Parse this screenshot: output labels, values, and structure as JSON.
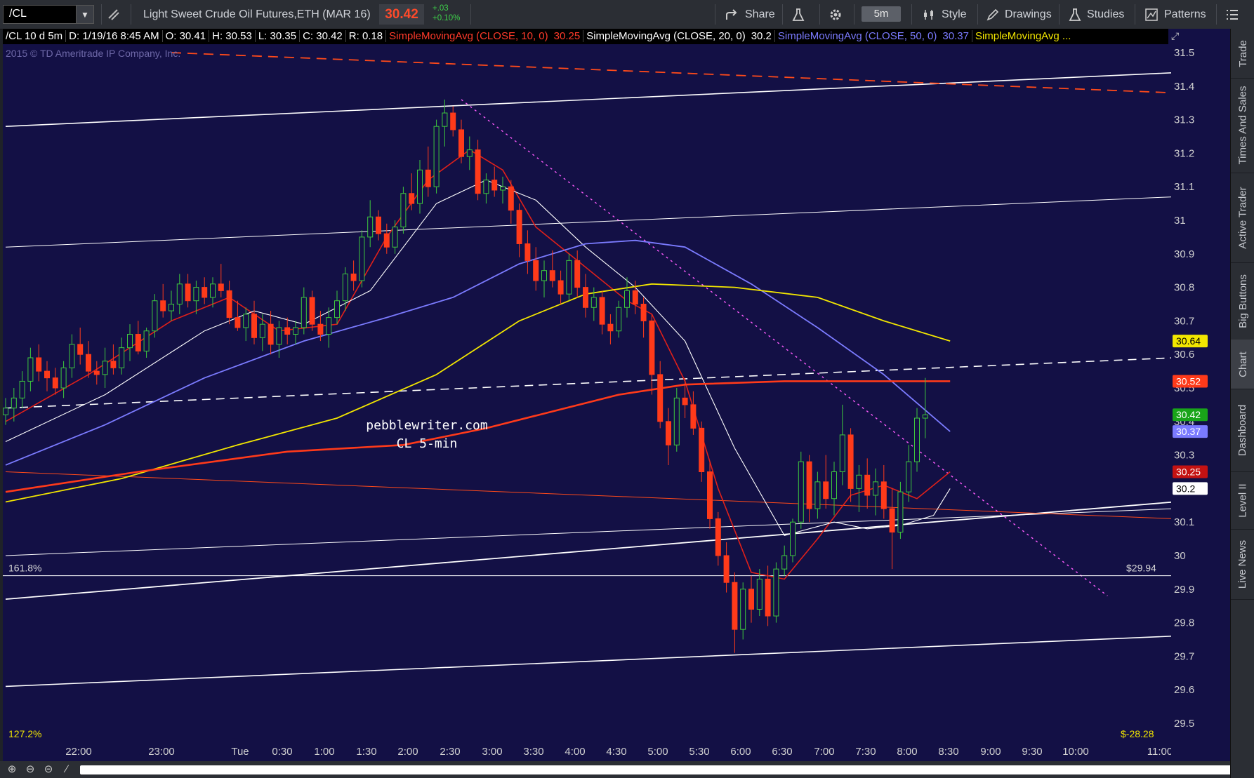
{
  "toolbar": {
    "symbol": "/CL",
    "instrument_name": "Light Sweet Crude Oil Futures,ETH (MAR 16)",
    "last_price": "30.42",
    "change_abs": "+.03",
    "change_pct": "+0.10%",
    "share_label": "Share",
    "timeframe_label": "5m",
    "style_label": "Style",
    "drawings_label": "Drawings",
    "studies_label": "Studies",
    "patterns_label": "Patterns"
  },
  "status": {
    "descriptor": "/CL 10 d 5m",
    "date": "D: 1/19/16 8:45 AM",
    "open": "O: 30.41",
    "high": "H: 30.53",
    "low": "L: 30.35",
    "close": "C: 30.42",
    "range": "R: 0.18",
    "sma10_label": "SimpleMovingAvg (CLOSE, 10, 0)",
    "sma10_value": "30.25",
    "sma20_label": "SimpleMovingAvg (CLOSE, 20, 0)",
    "sma20_value": "30.2",
    "sma50_label": "SimpleMovingAvg (CLOSE, 50, 0)",
    "sma50_value": "30.37",
    "sma_more_label": "SimpleMovingAvg ..."
  },
  "chart_data": {
    "type": "candlestick",
    "copyright": "2015 © TD Ameritrade IP Company, Inc.",
    "watermark": [
      "pebblewriter.com",
      "CL 5-min"
    ],
    "y_ticks": [
      31.5,
      31.4,
      31.3,
      31.2,
      31.1,
      31,
      30.9,
      30.8,
      30.7,
      30.6,
      30.5,
      30.4,
      30.3,
      30.2,
      30.1,
      30,
      29.9,
      29.8,
      29.7,
      29.6,
      29.5
    ],
    "y_tick_labels": [
      "31.5",
      "31.4",
      "31.3",
      "31.2",
      "31.1",
      "31",
      "30.9",
      "30.8",
      "30.7",
      "30.6",
      "30.5",
      "30.4",
      "30.3",
      "30.2",
      "30.1",
      "30",
      "29.9",
      "29.8",
      "29.7",
      "29.6",
      "29.5"
    ],
    "ylim": [
      29.44,
      31.55
    ],
    "x_labels": [
      "22:00",
      "23:00",
      "Tue",
      "0:30",
      "1:00",
      "1:30",
      "2:00",
      "2:30",
      "3:00",
      "3:30",
      "4:00",
      "4:30",
      "5:00",
      "5:30",
      "6:00",
      "6:30",
      "7:00",
      "7:30",
      "8:00",
      "8:30",
      "9:00",
      "9:30",
      "10:00",
      "11:00"
    ],
    "price_badges": [
      {
        "label": "30.64",
        "value": 30.64,
        "color": "#f2e600",
        "text_color": "#000000"
      },
      {
        "label": "30.52",
        "value": 30.52,
        "color": "#ff3a1a",
        "text_color": "#ffffff"
      },
      {
        "label": "30.42",
        "value": 30.42,
        "color": "#19a419",
        "text_color": "#ffffff"
      },
      {
        "label": "30.37",
        "value": 30.37,
        "color": "#7b7bff",
        "text_color": "#ffffff"
      },
      {
        "label": "30.25",
        "value": 30.25,
        "color": "#c41212",
        "text_color": "#ffffff"
      },
      {
        "label": "30.2",
        "value": 30.2,
        "color": "#ffffff",
        "text_color": "#000000"
      }
    ],
    "annotations": {
      "fib_left_top": "161.8%",
      "fib_left_bottom": "127.2%",
      "fib_right_top": "$29.94",
      "fib_right_bottom": "$-28.28",
      "fib_level": 29.94
    },
    "candles": [
      [
        30.42,
        30.47,
        30.39,
        30.44
      ],
      [
        30.44,
        30.5,
        30.4,
        30.47
      ],
      [
        30.47,
        30.55,
        30.44,
        30.52
      ],
      [
        30.52,
        30.62,
        30.49,
        30.59
      ],
      [
        30.59,
        30.63,
        30.52,
        30.55
      ],
      [
        30.55,
        30.58,
        30.49,
        30.53
      ],
      [
        30.53,
        30.56,
        30.48,
        30.5
      ],
      [
        30.5,
        30.58,
        30.47,
        30.56
      ],
      [
        30.56,
        30.66,
        30.53,
        30.63
      ],
      [
        30.63,
        30.68,
        30.57,
        30.6
      ],
      [
        30.6,
        30.64,
        30.53,
        30.55
      ],
      [
        30.55,
        30.58,
        30.51,
        30.54
      ],
      [
        30.54,
        30.62,
        30.5,
        30.58
      ],
      [
        30.58,
        30.63,
        30.54,
        30.56
      ],
      [
        30.56,
        30.65,
        30.54,
        30.62
      ],
      [
        30.62,
        30.69,
        30.58,
        30.66
      ],
      [
        30.66,
        30.7,
        30.6,
        30.61
      ],
      [
        30.61,
        30.68,
        30.59,
        30.67
      ],
      [
        30.67,
        30.78,
        30.65,
        30.76
      ],
      [
        30.76,
        30.81,
        30.71,
        30.73
      ],
      [
        30.73,
        30.79,
        30.7,
        30.75
      ],
      [
        30.75,
        30.84,
        30.72,
        30.81
      ],
      [
        30.81,
        30.84,
        30.74,
        30.76
      ],
      [
        30.76,
        30.82,
        30.72,
        30.8
      ],
      [
        30.8,
        30.83,
        30.75,
        30.77
      ],
      [
        30.77,
        30.83,
        30.74,
        30.81
      ],
      [
        30.81,
        30.87,
        30.77,
        30.79
      ],
      [
        30.79,
        30.82,
        30.69,
        30.71
      ],
      [
        30.71,
        30.76,
        30.67,
        30.68
      ],
      [
        30.68,
        30.74,
        30.64,
        30.72
      ],
      [
        30.72,
        30.76,
        30.63,
        30.65
      ],
      [
        30.65,
        30.72,
        30.61,
        30.69
      ],
      [
        30.69,
        30.73,
        30.6,
        30.63
      ],
      [
        30.63,
        30.7,
        30.59,
        30.68
      ],
      [
        30.68,
        30.71,
        30.63,
        30.66
      ],
      [
        30.66,
        30.7,
        30.63,
        30.68
      ],
      [
        30.68,
        30.8,
        30.66,
        30.77
      ],
      [
        30.77,
        30.79,
        30.67,
        30.69
      ],
      [
        30.69,
        30.73,
        30.64,
        30.66
      ],
      [
        30.66,
        30.74,
        30.62,
        30.71
      ],
      [
        30.71,
        30.79,
        30.69,
        30.76
      ],
      [
        30.76,
        30.86,
        30.73,
        30.84
      ],
      [
        30.84,
        30.88,
        30.79,
        30.82
      ],
      [
        30.82,
        30.97,
        30.8,
        30.95
      ],
      [
        30.95,
        31.06,
        30.92,
        31.01
      ],
      [
        31.01,
        31.03,
        30.94,
        30.96
      ],
      [
        30.96,
        30.99,
        30.9,
        30.92
      ],
      [
        30.92,
        31.0,
        30.9,
        30.98
      ],
      [
        30.98,
        31.1,
        30.96,
        31.08
      ],
      [
        31.08,
        31.14,
        31.03,
        31.05
      ],
      [
        31.05,
        31.18,
        31.02,
        31.15
      ],
      [
        31.15,
        31.22,
        31.07,
        31.1
      ],
      [
        31.1,
        31.3,
        31.08,
        31.28
      ],
      [
        31.28,
        31.36,
        31.22,
        31.32
      ],
      [
        31.32,
        31.34,
        31.25,
        31.27
      ],
      [
        31.27,
        31.3,
        31.17,
        31.19
      ],
      [
        31.19,
        31.25,
        31.15,
        31.21
      ],
      [
        31.21,
        31.24,
        31.06,
        31.08
      ],
      [
        31.08,
        31.14,
        31.05,
        31.12
      ],
      [
        31.12,
        31.16,
        31.07,
        31.09
      ],
      [
        31.09,
        31.13,
        31.05,
        31.1
      ],
      [
        31.1,
        31.12,
        30.99,
        31.03
      ],
      [
        31.03,
        31.05,
        30.89,
        30.93
      ],
      [
        30.93,
        30.97,
        30.84,
        30.88
      ],
      [
        30.88,
        30.92,
        30.79,
        30.82
      ],
      [
        30.82,
        30.88,
        30.77,
        30.85
      ],
      [
        30.85,
        30.91,
        30.8,
        30.82
      ],
      [
        30.82,
        30.85,
        30.75,
        30.78
      ],
      [
        30.78,
        30.9,
        30.76,
        30.88
      ],
      [
        30.88,
        30.91,
        30.77,
        30.8
      ],
      [
        30.8,
        30.84,
        30.71,
        30.74
      ],
      [
        30.74,
        30.8,
        30.7,
        30.77
      ],
      [
        30.77,
        30.79,
        30.66,
        30.69
      ],
      [
        30.69,
        30.72,
        30.63,
        30.67
      ],
      [
        30.67,
        30.76,
        30.65,
        30.74
      ],
      [
        30.74,
        30.83,
        30.71,
        30.79
      ],
      [
        30.79,
        30.82,
        30.72,
        30.75
      ],
      [
        30.75,
        30.77,
        30.65,
        30.7
      ],
      [
        30.7,
        30.72,
        30.48,
        30.54
      ],
      [
        30.54,
        30.58,
        30.38,
        30.4
      ],
      [
        30.4,
        30.44,
        30.27,
        30.33
      ],
      [
        30.33,
        30.5,
        30.31,
        30.47
      ],
      [
        30.47,
        30.53,
        30.41,
        30.45
      ],
      [
        30.45,
        30.49,
        30.36,
        30.38
      ],
      [
        30.38,
        30.4,
        30.22,
        30.25
      ],
      [
        30.25,
        30.28,
        30.08,
        30.11
      ],
      [
        30.11,
        30.13,
        29.97,
        30.0
      ],
      [
        30.0,
        30.04,
        29.89,
        29.92
      ],
      [
        29.92,
        29.95,
        29.71,
        29.78
      ],
      [
        29.78,
        29.92,
        29.75,
        29.9
      ],
      [
        29.9,
        29.94,
        29.8,
        29.84
      ],
      [
        29.84,
        29.96,
        29.82,
        29.93
      ],
      [
        29.93,
        29.97,
        29.79,
        29.82
      ],
      [
        29.82,
        29.98,
        29.8,
        29.96
      ],
      [
        29.96,
        30.03,
        29.94,
        30.0
      ],
      [
        30.0,
        30.11,
        29.98,
        30.1
      ],
      [
        30.1,
        30.31,
        30.08,
        30.28
      ],
      [
        30.28,
        30.3,
        30.1,
        30.14
      ],
      [
        30.14,
        30.25,
        30.11,
        30.22
      ],
      [
        30.22,
        30.3,
        30.14,
        30.17
      ],
      [
        30.17,
        30.28,
        30.12,
        30.25
      ],
      [
        30.25,
        30.45,
        30.21,
        30.36
      ],
      [
        30.36,
        30.38,
        30.16,
        30.2
      ],
      [
        30.2,
        30.27,
        30.13,
        30.24
      ],
      [
        30.24,
        30.29,
        30.14,
        30.18
      ],
      [
        30.18,
        30.26,
        30.12,
        30.22
      ],
      [
        30.22,
        30.27,
        30.11,
        30.14
      ],
      [
        30.14,
        30.2,
        29.96,
        30.07
      ],
      [
        30.07,
        30.22,
        30.05,
        30.19
      ],
      [
        30.19,
        30.33,
        30.16,
        30.28
      ],
      [
        30.28,
        30.44,
        30.25,
        30.41
      ],
      [
        30.41,
        30.53,
        30.35,
        30.42
      ]
    ],
    "moving_averages": [
      {
        "name": "SMA 10",
        "color": "#e0201a",
        "width": 1.6,
        "points": [
          [
            0,
            30.4
          ],
          [
            10,
            30.54
          ],
          [
            20,
            30.7
          ],
          [
            27,
            30.77
          ],
          [
            33,
            30.67
          ],
          [
            40,
            30.69
          ],
          [
            46,
            30.95
          ],
          [
            51,
            31.12
          ],
          [
            56,
            31.21
          ],
          [
            60,
            31.15
          ],
          [
            64,
            30.98
          ],
          [
            70,
            30.86
          ],
          [
            75,
            30.76
          ],
          [
            78,
            30.72
          ],
          [
            82,
            30.52
          ],
          [
            86,
            30.2
          ],
          [
            90,
            29.95
          ],
          [
            94,
            29.93
          ],
          [
            98,
            30.05
          ],
          [
            102,
            30.18
          ],
          [
            106,
            30.21
          ],
          [
            110,
            30.17
          ],
          [
            114,
            30.25
          ]
        ]
      },
      {
        "name": "SMA 20",
        "color": "#ffffff",
        "width": 1.1,
        "points": [
          [
            0,
            30.34
          ],
          [
            12,
            30.48
          ],
          [
            24,
            30.67
          ],
          [
            30,
            30.73
          ],
          [
            36,
            30.69
          ],
          [
            44,
            30.79
          ],
          [
            52,
            31.05
          ],
          [
            58,
            31.12
          ],
          [
            64,
            31.06
          ],
          [
            70,
            30.92
          ],
          [
            76,
            30.8
          ],
          [
            82,
            30.64
          ],
          [
            88,
            30.32
          ],
          [
            94,
            30.06
          ],
          [
            100,
            30.1
          ],
          [
            104,
            30.08
          ],
          [
            108,
            30.09
          ],
          [
            112,
            30.12
          ],
          [
            114,
            30.2
          ]
        ]
      },
      {
        "name": "SMA 50",
        "color": "#7b7bff",
        "width": 1.8,
        "points": [
          [
            0,
            30.27
          ],
          [
            12,
            30.39
          ],
          [
            24,
            30.53
          ],
          [
            36,
            30.64
          ],
          [
            46,
            30.71
          ],
          [
            54,
            30.77
          ],
          [
            62,
            30.87
          ],
          [
            70,
            30.93
          ],
          [
            76,
            30.94
          ],
          [
            82,
            30.92
          ],
          [
            90,
            30.81
          ],
          [
            98,
            30.68
          ],
          [
            106,
            30.54
          ],
          [
            114,
            30.37
          ]
        ]
      },
      {
        "name": "SMA 100",
        "color": "#f2e600",
        "width": 1.8,
        "points": [
          [
            0,
            30.16
          ],
          [
            14,
            30.23
          ],
          [
            28,
            30.33
          ],
          [
            40,
            30.41
          ],
          [
            52,
            30.54
          ],
          [
            62,
            30.7
          ],
          [
            70,
            30.78
          ],
          [
            78,
            30.81
          ],
          [
            88,
            30.8
          ],
          [
            98,
            30.77
          ],
          [
            106,
            30.7
          ],
          [
            114,
            30.64
          ]
        ]
      },
      {
        "name": "SMA 200",
        "color": "#ff3a1a",
        "width": 2.6,
        "points": [
          [
            0,
            30.19
          ],
          [
            16,
            30.25
          ],
          [
            34,
            30.31
          ],
          [
            48,
            30.33
          ],
          [
            58,
            30.38
          ],
          [
            66,
            30.43
          ],
          [
            74,
            30.48
          ],
          [
            82,
            30.51
          ],
          [
            94,
            30.52
          ],
          [
            104,
            30.52
          ],
          [
            114,
            30.52
          ]
        ]
      }
    ],
    "trendlines": [
      {
        "from": [
          0,
          31.28
        ],
        "to": [
          141,
          31.44
        ],
        "color": "#ffffff",
        "width": 1.6,
        "dash": "none"
      },
      {
        "from": [
          0,
          30.92
        ],
        "to": [
          141,
          31.07
        ],
        "color": "#ffffff",
        "width": 1,
        "dash": "none"
      },
      {
        "from": [
          0,
          30.0
        ],
        "to": [
          141,
          30.14
        ],
        "color": "#ffffff",
        "width": 1,
        "dash": "none"
      },
      {
        "from": [
          0,
          29.87
        ],
        "to": [
          141,
          30.16
        ],
        "color": "#ffffff",
        "width": 1.8,
        "dash": "none"
      },
      {
        "from": [
          0,
          29.61
        ],
        "to": [
          141,
          29.76
        ],
        "color": "#ffffff",
        "width": 1.6,
        "dash": "none"
      },
      {
        "from": [
          0,
          30.44
        ],
        "to": [
          141,
          30.59
        ],
        "color": "#ffffff",
        "width": 1.6,
        "dash": "12 8"
      },
      {
        "from": [
          20,
          31.5
        ],
        "to": [
          141,
          31.38
        ],
        "color": "#ff4a1a",
        "width": 1.8,
        "dash": "14 9"
      },
      {
        "from": [
          0,
          30.25
        ],
        "to": [
          141,
          30.11
        ],
        "color": "#ff4a1a",
        "width": 1,
        "dash": "none"
      },
      {
        "from": [
          55,
          31.36
        ],
        "to": [
          133,
          29.88
        ],
        "color": "#ff5cff",
        "width": 1.4,
        "dash": "3 5"
      }
    ]
  }
}
